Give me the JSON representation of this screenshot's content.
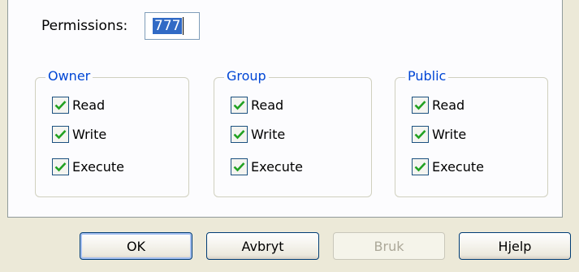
{
  "permissions": {
    "label": "Permissions:",
    "value": "777"
  },
  "groups": [
    {
      "title": "Owner",
      "items": [
        {
          "label": "Read",
          "checked": true
        },
        {
          "label": "Write",
          "checked": true
        },
        {
          "label": "Execute",
          "checked": true
        }
      ]
    },
    {
      "title": "Group",
      "items": [
        {
          "label": "Read",
          "checked": true
        },
        {
          "label": "Write",
          "checked": true
        },
        {
          "label": "Execute",
          "checked": true
        }
      ]
    },
    {
      "title": "Public",
      "items": [
        {
          "label": "Read",
          "checked": true
        },
        {
          "label": "Write",
          "checked": true
        },
        {
          "label": "Execute",
          "checked": true
        }
      ]
    }
  ],
  "buttons": {
    "ok": "OK",
    "cancel": "Avbryt",
    "apply": "Bruk",
    "help": "Hjelp"
  },
  "colors": {
    "check": "#21a121",
    "group_title": "#0046d5",
    "selection": "#316ac5"
  }
}
